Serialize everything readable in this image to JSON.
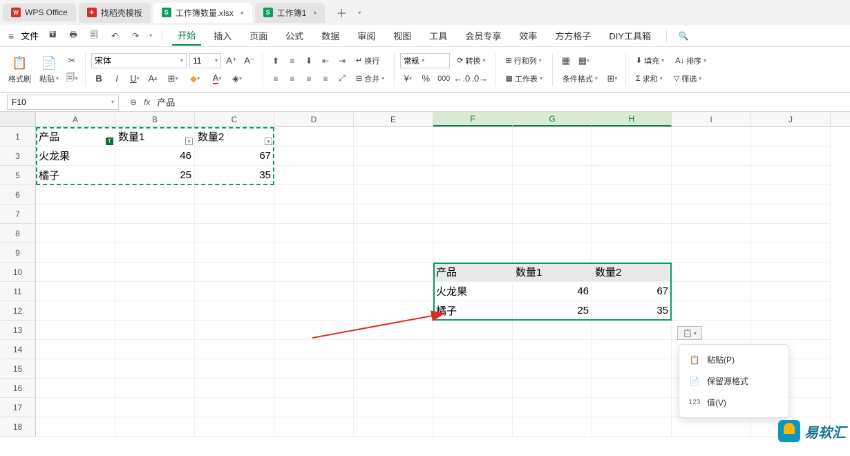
{
  "tabs": {
    "wps": "WPS Office",
    "daoke": "找稻壳模板",
    "file1": "工作簿数量.xlsx",
    "file2": "工作簿1"
  },
  "menu": {
    "file": "文件",
    "items": [
      "开始",
      "插入",
      "页面",
      "公式",
      "数据",
      "审阅",
      "视图",
      "工具",
      "会员专享",
      "效率",
      "方方格子",
      "DIY工具箱"
    ]
  },
  "toolbar": {
    "format_painter": "格式刷",
    "paste": "粘贴",
    "font_name": "宋体",
    "font_size": "11",
    "wrap": "换行",
    "merge": "合并",
    "number_format": "常规",
    "convert": "转换",
    "rowcol": "行和列",
    "worksheet": "工作表",
    "cond_fmt": "条件格式",
    "fill": "填充",
    "sum": "求和",
    "sort": "排序",
    "filter": "筛选"
  },
  "namebox": "F10",
  "formula": "产品",
  "columns": [
    "A",
    "B",
    "C",
    "D",
    "E",
    "F",
    "G",
    "H",
    "I",
    "J"
  ],
  "rows": [
    "1",
    "3",
    "5",
    "6",
    "7",
    "8",
    "9",
    "10",
    "11",
    "12",
    "13",
    "14",
    "15",
    "16",
    "17",
    "18"
  ],
  "source_table": {
    "headers": [
      "产品",
      "数量1",
      "数量2"
    ],
    "rows": [
      [
        "火龙果",
        "46",
        "67"
      ],
      [
        "橘子",
        "25",
        "35"
      ]
    ]
  },
  "paste_table": {
    "headers": [
      "产品",
      "数量1",
      "数量2"
    ],
    "rows": [
      [
        "火龙果",
        "46",
        "67"
      ],
      [
        "橘子",
        "25",
        "35"
      ]
    ]
  },
  "paste_menu": {
    "paste": "粘贴(P)",
    "keep_source": "保留源格式",
    "values": "值(V)"
  },
  "watermark": "易软汇"
}
